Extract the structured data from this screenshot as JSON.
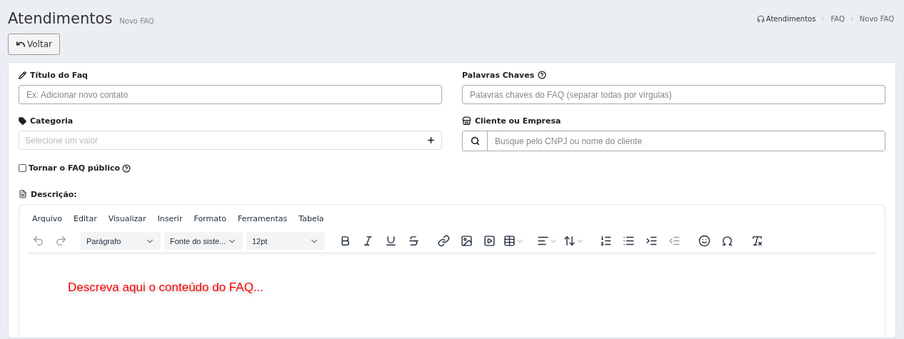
{
  "header": {
    "title": "Atendimentos",
    "subtitle": "Novo FAQ"
  },
  "breadcrumb": [
    {
      "label": "Atendimentos",
      "kind": "home"
    },
    {
      "label": "FAQ",
      "kind": "link"
    },
    {
      "label": "Novo FAQ",
      "kind": "link"
    }
  ],
  "back_button": {
    "label": "Voltar"
  },
  "form": {
    "title_field": {
      "label": "Título do Faq",
      "placeholder": "Ex: Adicionar novo contato"
    },
    "keywords_field": {
      "label": "Palavras Chaves",
      "placeholder": "Palavras chaves do FAQ (separar todas por vírgulas)"
    },
    "category_field": {
      "label": "Categoria",
      "placeholder": "Selecione um valor"
    },
    "client_field": {
      "label": "Cliente ou Empresa",
      "placeholder": "Busque pelo CNPJ ou nome do cliente"
    },
    "public_checkbox": {
      "label": "Tornar o FAQ público",
      "checked": false
    },
    "description_label": "Descrição:"
  },
  "editor": {
    "menu": [
      "Arquivo",
      "Editar",
      "Visualizar",
      "Inserir",
      "Formato",
      "Ferramentas",
      "Tabela"
    ],
    "toolbar_groups": [
      [
        {
          "kind": "undo",
          "disabled": true
        },
        {
          "kind": "redo",
          "disabled": true
        }
      ],
      [
        {
          "kind": "select",
          "value": "Parágrafo"
        },
        {
          "kind": "select",
          "value": "Fonte do siste..."
        },
        {
          "kind": "select",
          "value": "12pt"
        }
      ],
      [
        {
          "kind": "bold",
          "disabled": false
        },
        {
          "kind": "italic",
          "disabled": false
        },
        {
          "kind": "underline",
          "disabled": false
        },
        {
          "kind": "strikethrough",
          "disabled": false
        }
      ],
      [
        {
          "kind": "link",
          "disabled": false
        },
        {
          "kind": "image",
          "disabled": false
        },
        {
          "kind": "media",
          "disabled": false
        },
        {
          "kind": "table",
          "disabled": false
        }
      ],
      [
        {
          "kind": "align",
          "disabled": false
        },
        {
          "kind": "line-height",
          "disabled": false
        }
      ],
      [
        {
          "kind": "ordered-list",
          "disabled": false
        },
        {
          "kind": "bullet-list",
          "disabled": false
        },
        {
          "kind": "indent",
          "disabled": false
        },
        {
          "kind": "outdent",
          "disabled": true
        }
      ],
      [
        {
          "kind": "emoji",
          "disabled": false
        },
        {
          "kind": "special-char",
          "disabled": false
        }
      ],
      [
        {
          "kind": "clear-format",
          "disabled": false
        }
      ]
    ],
    "content": "Descreva aqui o conteúdo do FAQ..."
  }
}
